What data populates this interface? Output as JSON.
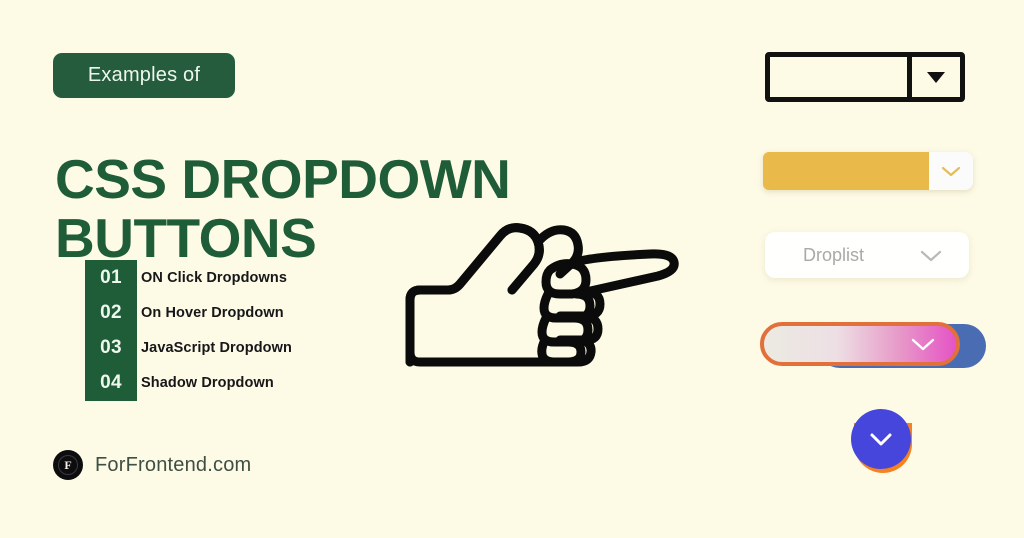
{
  "theme": {
    "background": "#fdfae6",
    "green": "#1f5c38",
    "badge_green": "#245c3d",
    "cream_text": "#eef7ee",
    "dark_text": "#17171a",
    "brand_text": "#3f4f43",
    "gold": "#e9b949",
    "orange": "#e2703a",
    "blue": "#4646dc",
    "behind_blue": "#3a5fae",
    "crescent_orange": "#f5821f",
    "droplist_text": "#a9a9a6",
    "outline_black": "#111111"
  },
  "hero": {
    "badge_label": "Examples of",
    "title_line1": "CSS DROPDOWN",
    "title_line2": "BUTTONS"
  },
  "list": {
    "items": [
      {
        "number": "01",
        "label": "ON Click Dropdowns"
      },
      {
        "number": "02",
        "label": "On Hover Dropdown"
      },
      {
        "number": "03",
        "label": "JavaScript Dropdown"
      },
      {
        "number": "04",
        "label": "Shadow Dropdown"
      }
    ]
  },
  "brand": {
    "mark_glyph": "F",
    "name": "ForFrontend.com"
  },
  "illustration": {
    "name": "pointing-hand"
  },
  "widgets": [
    {
      "name": "classic-outlined-select",
      "style": "outlined",
      "value": "",
      "icon": "triangle-down-icon"
    },
    {
      "name": "gold-bar-dropdown",
      "style": "gold",
      "value": "",
      "icon": "chevron-down-icon"
    },
    {
      "name": "droplist-dropdown",
      "style": "white-card",
      "value": "Droplist",
      "icon": "chevron-down-icon"
    },
    {
      "name": "gradient-pill-dropdown",
      "style": "gradient",
      "value": "",
      "icon": "chevron-down-icon"
    },
    {
      "name": "circular-dropdown-button",
      "style": "circle",
      "value": "",
      "icon": "chevron-down-icon"
    }
  ]
}
